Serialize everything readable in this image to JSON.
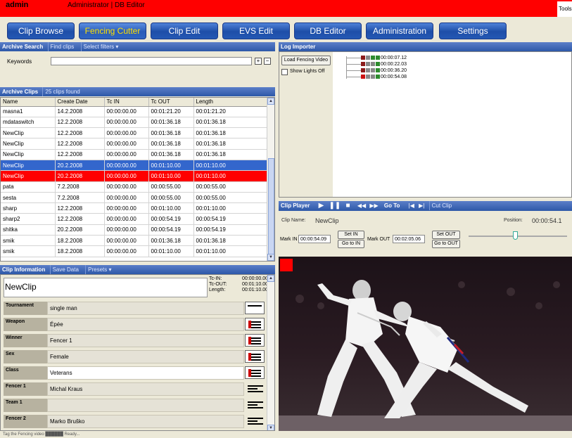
{
  "titlebar": {
    "user": "admin",
    "title": "Administrator | DB Editor",
    "tools": "Tools"
  },
  "nav": [
    {
      "label": "Clip Browse",
      "active": false
    },
    {
      "label": "Fencing Cutter",
      "active": true
    },
    {
      "label": "Clip Edit",
      "active": false
    },
    {
      "label": "EVS Edit",
      "active": false
    },
    {
      "label": "DB Editor",
      "active": false
    },
    {
      "label": "Administration",
      "active": false
    },
    {
      "label": "Settings",
      "active": false
    }
  ],
  "archive_search": {
    "header": "Archive Search",
    "tabs": [
      "Find clips",
      "Select filters ▾"
    ],
    "keywords_label": "Keywords",
    "keywords_value": "",
    "add": "+",
    "remove": "−"
  },
  "archive_clips": {
    "header": "Archive Clips",
    "found": "25 clips found",
    "columns": [
      "Name",
      "Create Date",
      "Tc IN",
      "Tc OUT",
      "Length"
    ],
    "rows": [
      [
        "masna1",
        "14.2.2008",
        "00:00:00.00",
        "00:01:21.20",
        "00:01:21.20"
      ],
      [
        "mdataswitch",
        "12.2.2008",
        "00:00:00.00",
        "00:01:36.18",
        "00:01:36.18"
      ],
      [
        "NewClip",
        "12.2.2008",
        "00:00:00.00",
        "00:01:36.18",
        "00:01:36.18"
      ],
      [
        "NewClip",
        "12.2.2008",
        "00:00:00.00",
        "00:01:36.18",
        "00:01:36.18"
      ],
      [
        "NewClip",
        "12.2.2008",
        "00:00:00.00",
        "00:01:36.18",
        "00:01:36.18"
      ],
      [
        "NewClip",
        "20.2.2008",
        "00:00:00.00",
        "00:01:10.00",
        "00:01:10.00"
      ],
      [
        "NewClip",
        "20.2.2008",
        "00:00:00.00",
        "00:01:10.00",
        "00:01:10.00"
      ],
      [
        "pata",
        "7.2.2008",
        "00:00:00.00",
        "00:00:55.00",
        "00:00:55.00"
      ],
      [
        "sesta",
        "7.2.2008",
        "00:00:00.00",
        "00:00:55.00",
        "00:00:55.00"
      ],
      [
        "sharp",
        "12.2.2008",
        "00:00:00.00",
        "00:01:10.00",
        "00:01:10.00"
      ],
      [
        "sharp2",
        "12.2.2008",
        "00:00:00.00",
        "00:00:54.19",
        "00:00:54.19"
      ],
      [
        "shitka",
        "20.2.2008",
        "00:00:00.00",
        "00:00:54.19",
        "00:00:54.19"
      ],
      [
        "smik",
        "18.2.2008",
        "00:00:00.00",
        "00:01:36.18",
        "00:01:36.18"
      ],
      [
        "smik",
        "18.2.2008",
        "00:00:00.00",
        "00:01:10.00",
        "00:01:10.00"
      ]
    ],
    "selected_row": 5,
    "highlighted_row": 6
  },
  "clip_info": {
    "header": "Clip Information",
    "tabs": [
      "Save Data",
      "Presets ▾"
    ],
    "clip_name": "NewClip",
    "tc_in_label": "Tc-IN:",
    "tc_in": "00:00:00.00",
    "tc_out_label": "Tc-OUT:",
    "tc_out": "00:01:10.00",
    "length_label": "Length:",
    "length": "00:01:10.00",
    "fields": [
      {
        "label": "Tournament",
        "value": "single man",
        "white": false,
        "icon": "plain"
      },
      {
        "label": "Weapon",
        "value": "Épée",
        "white": false,
        "icon": "list"
      },
      {
        "label": "Winner",
        "value": "Fencer 1",
        "white": false,
        "icon": "list"
      },
      {
        "label": "Sex",
        "value": "Female",
        "white": false,
        "icon": "list"
      },
      {
        "label": "Class",
        "value": "Veterans",
        "white": true,
        "icon": "list"
      },
      {
        "label": "Fencer 1",
        "value": "Michal Kraus",
        "white": false,
        "icon": "lines"
      },
      {
        "label": "Team 1",
        "value": "",
        "white": false,
        "icon": "lines"
      },
      {
        "label": "Fencer 2",
        "value": "Marko Bruško",
        "white": false,
        "icon": "lines"
      }
    ]
  },
  "log_importer": {
    "header": "Log Importer",
    "load_button": "Load Fencing Video",
    "show_lights": "Show Lights Off",
    "entries": [
      {
        "time": "00:00:07.12",
        "colors": [
          "#8b1a1a",
          "#888888",
          "#2e8b2e",
          "#2e8b2e"
        ]
      },
      {
        "time": "00:00:22.03",
        "colors": [
          "#8b1a1a",
          "#888888",
          "#888888",
          "#2e8b2e"
        ]
      },
      {
        "time": "00:00:36.20",
        "colors": [
          "#8b1a1a",
          "#888888",
          "#888888",
          "#2e8b2e"
        ]
      },
      {
        "time": "00:00:54.08",
        "colors": [
          "#cc1111",
          "#888888",
          "#888888",
          "#2e8b2e"
        ]
      }
    ]
  },
  "clip_player": {
    "header": "Clip Player",
    "goto": "Go To",
    "cut": "Cut Clip",
    "clip_name_label": "Clip Name:",
    "clip_name": "NewClip",
    "position_label": "Position:",
    "position": "00:00:54.1",
    "mark_in_label": "Mark IN",
    "mark_in": "00:00:54.09",
    "set_in": "Set IN",
    "goto_in": "Go to IN",
    "mark_out_label": "Mark OUT",
    "mark_out": "00:02:05.06",
    "set_out": "Set OUT",
    "goto_out": "Go to OUT"
  },
  "status": {
    "text": "Tag the Fencing video   ██████    Ready..."
  },
  "colors": {
    "accent": "#ff0000",
    "selection": "#3366cc",
    "header": "#2d58a8"
  }
}
